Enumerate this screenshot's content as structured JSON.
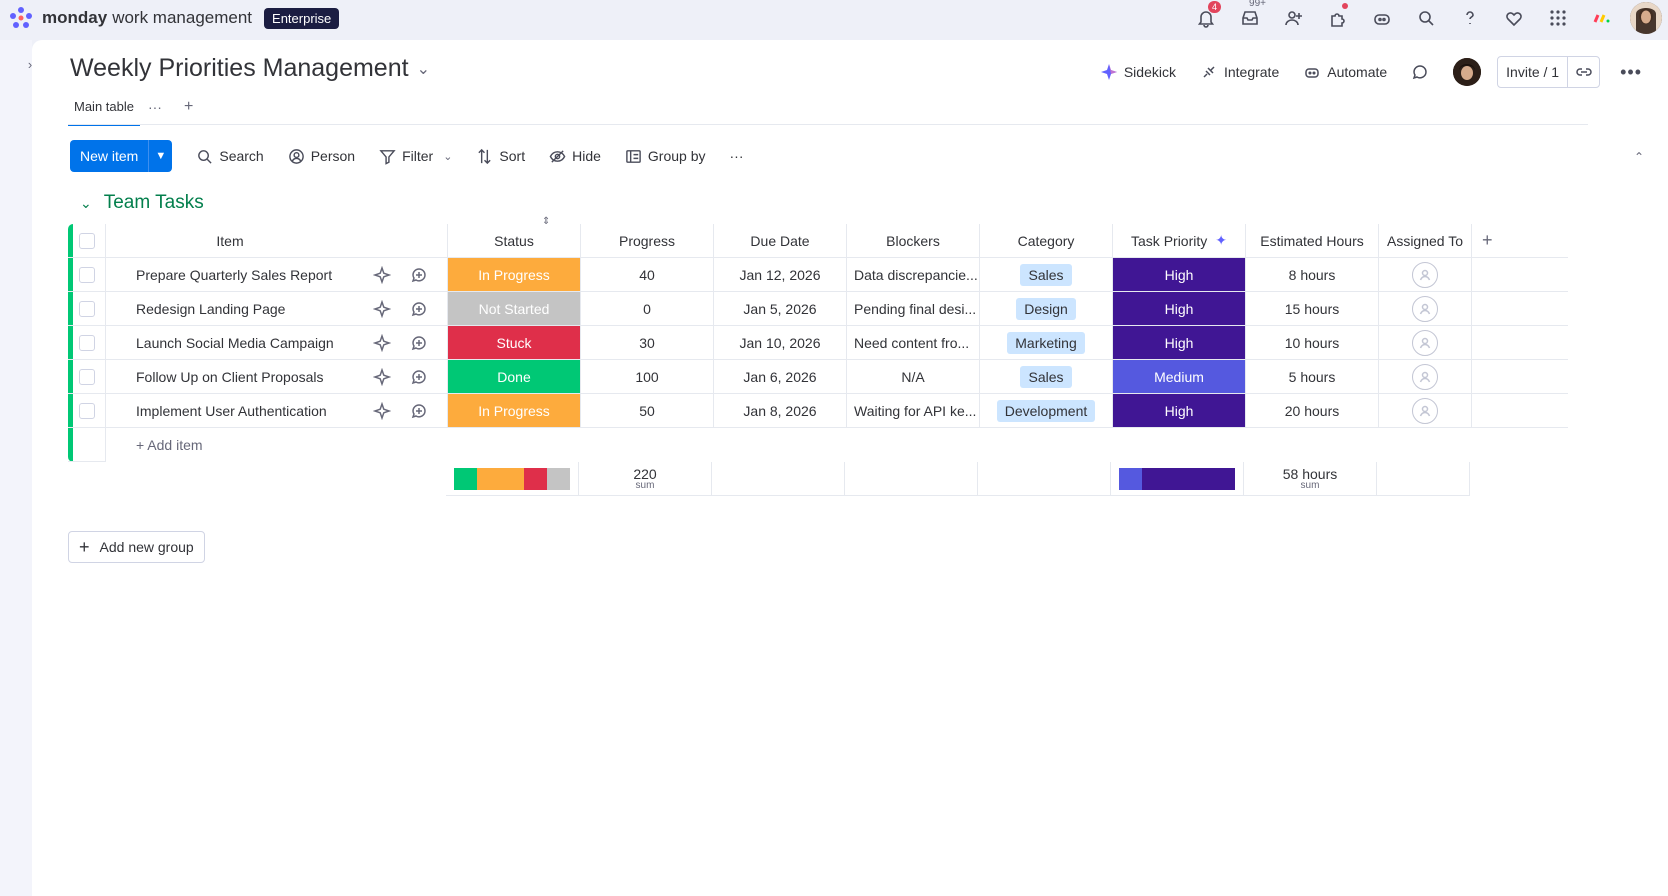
{
  "topbar": {
    "brand_bold": "monday",
    "brand_light": "work management",
    "plan": "Enterprise",
    "notifications_badge": "4",
    "inbox_badge": "99+"
  },
  "board": {
    "title": "Weekly Priorities Management",
    "tabs": [
      {
        "label": "Main table"
      }
    ]
  },
  "actions": {
    "sidekick": "Sidekick",
    "integrate": "Integrate",
    "automate": "Automate",
    "invite": "Invite / 1"
  },
  "toolbar": {
    "new_item": "New item",
    "search": "Search",
    "person": "Person",
    "filter": "Filter",
    "sort": "Sort",
    "hide": "Hide",
    "group_by": "Group by"
  },
  "group": {
    "title": "Team Tasks",
    "color": "#00c875",
    "columns": {
      "item": "Item",
      "status": "Status",
      "progress": "Progress",
      "due_date": "Due Date",
      "blockers": "Blockers",
      "category": "Category",
      "priority": "Task Priority",
      "hours": "Estimated Hours",
      "assigned": "Assigned To"
    },
    "rows": [
      {
        "item": "Prepare Quarterly Sales Report",
        "status": "In Progress",
        "status_color": "#fdab3d",
        "progress": "40",
        "due": "Jan 12, 2026",
        "blockers": "Data discrepancie...",
        "category": "Sales",
        "priority": "High",
        "priority_color": "#401694",
        "hours": "8 hours"
      },
      {
        "item": "Redesign Landing Page",
        "status": "Not Started",
        "status_color": "#c4c4c4",
        "progress": "0",
        "due": "Jan 5, 2026",
        "blockers": "Pending final desi...",
        "category": "Design",
        "priority": "High",
        "priority_color": "#401694",
        "hours": "15 hours"
      },
      {
        "item": "Launch Social Media Campaign",
        "status": "Stuck",
        "status_color": "#df2f4a",
        "progress": "30",
        "due": "Jan 10, 2026",
        "blockers": "Need content fro...",
        "category": "Marketing",
        "priority": "High",
        "priority_color": "#401694",
        "hours": "10 hours"
      },
      {
        "item": "Follow Up on Client Proposals",
        "status": "Done",
        "status_color": "#00c875",
        "progress": "100",
        "due": "Jan 6, 2026",
        "blockers": "N/A",
        "category": "Sales",
        "priority": "Medium",
        "priority_color": "#5559df",
        "hours": "5 hours"
      },
      {
        "item": "Implement User Authentication",
        "status": "In Progress",
        "status_color": "#fdab3d",
        "progress": "50",
        "due": "Jan 8, 2026",
        "blockers": "Waiting for API ke...",
        "category": "Development",
        "priority": "High",
        "priority_color": "#401694",
        "hours": "20 hours"
      }
    ],
    "add_item": "+ Add item",
    "summary": {
      "progress_sum": "220",
      "progress_label": "sum",
      "hours_sum": "58 hours",
      "hours_label": "sum",
      "status_bar": [
        {
          "fraction": 0.2,
          "color": "#00c875"
        },
        {
          "fraction": 0.4,
          "color": "#fdab3d"
        },
        {
          "fraction": 0.2,
          "color": "#df2f4a"
        },
        {
          "fraction": 0.2,
          "color": "#c4c4c4"
        }
      ],
      "priority_bar": [
        {
          "fraction": 0.2,
          "color": "#5559df"
        },
        {
          "fraction": 0.8,
          "color": "#401694"
        }
      ]
    }
  },
  "add_group": "Add new group"
}
